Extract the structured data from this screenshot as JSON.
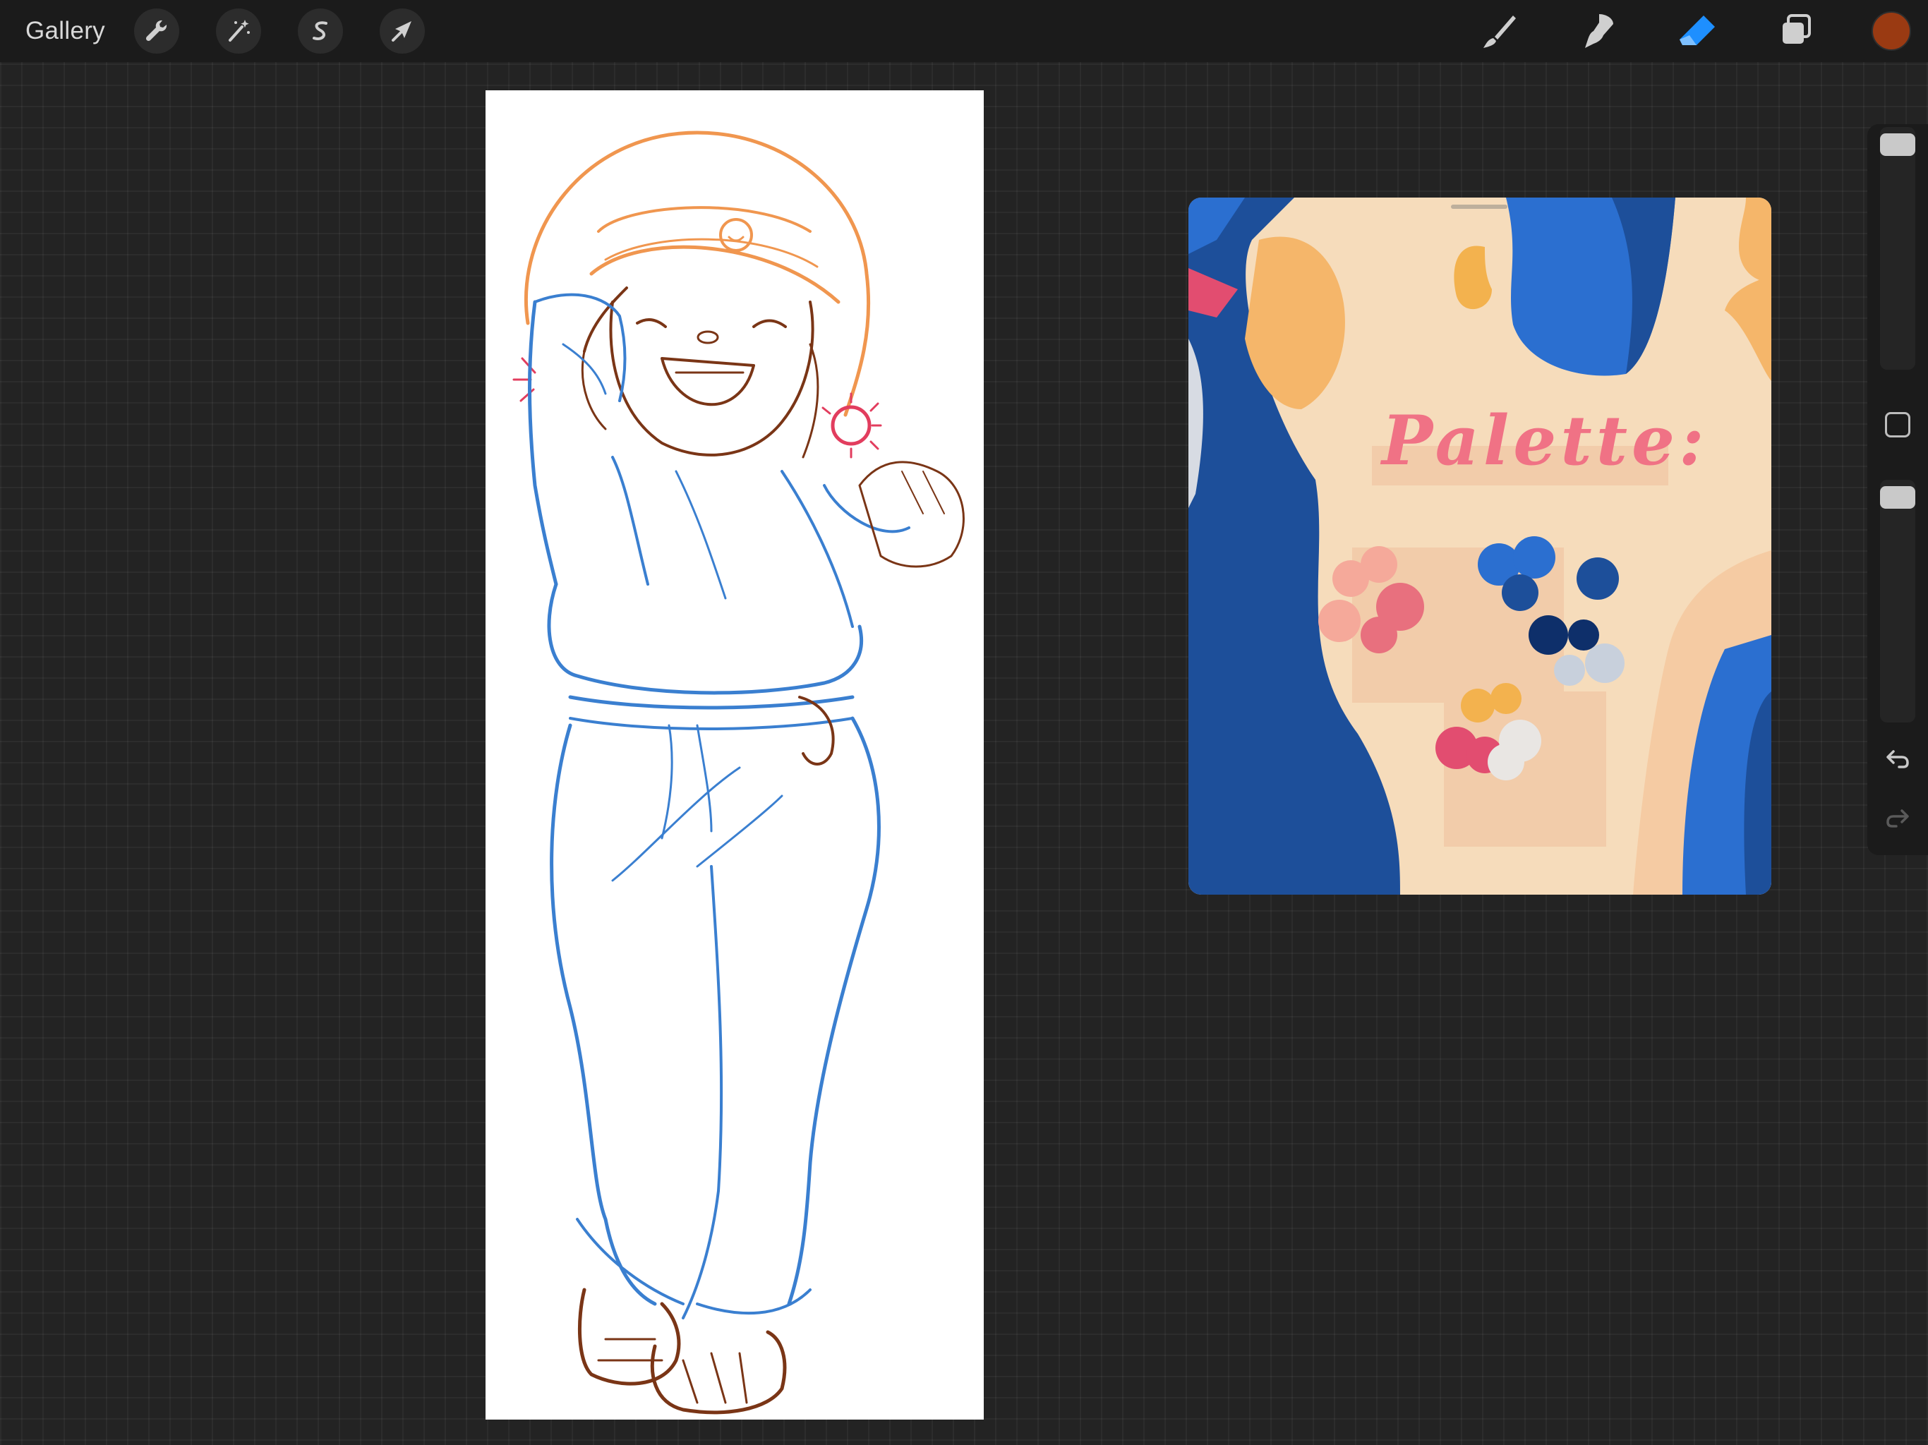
{
  "topbar": {
    "gallery_label": "Gallery",
    "left_tools": [
      {
        "icon": "wrench-icon",
        "name": "actions"
      },
      {
        "icon": "magic-wand-icon",
        "name": "adjustments"
      },
      {
        "icon": "selection-s-icon",
        "name": "selection"
      },
      {
        "icon": "transform-arrow-icon",
        "name": "transform"
      }
    ],
    "right_tools": [
      {
        "icon": "brush-icon",
        "name": "paint",
        "active": false
      },
      {
        "icon": "smudge-icon",
        "name": "smudge",
        "active": false
      },
      {
        "icon": "eraser-icon",
        "name": "erase",
        "active": true
      },
      {
        "icon": "layers-icon",
        "name": "layers",
        "active": false
      }
    ],
    "current_color": "#9a3a12",
    "active_tool_color": "#1e8fff"
  },
  "canvas": {
    "background": "#ffffff",
    "sketch_colors": {
      "hat": "#f0964f",
      "outline": "#7a3516",
      "clothes": "#3a7fd0",
      "blush": "#e23d5e"
    }
  },
  "reference_window": {
    "title": "Palette:",
    "background": "#f6dcbb",
    "palette_colors": [
      "#f5a99a",
      "#e8707e",
      "#2b6fd0",
      "#1d4f9a",
      "#0e2f6a",
      "#c8d0dc",
      "#f3b24e",
      "#e24d70",
      "#e9e6e3"
    ]
  },
  "sidebar": {
    "brush_size_level": 0.03,
    "opacity_level": 0.03,
    "undo_icon": "undo-icon",
    "redo_icon": "redo-icon",
    "modify_icon": "square-modify-icon"
  }
}
